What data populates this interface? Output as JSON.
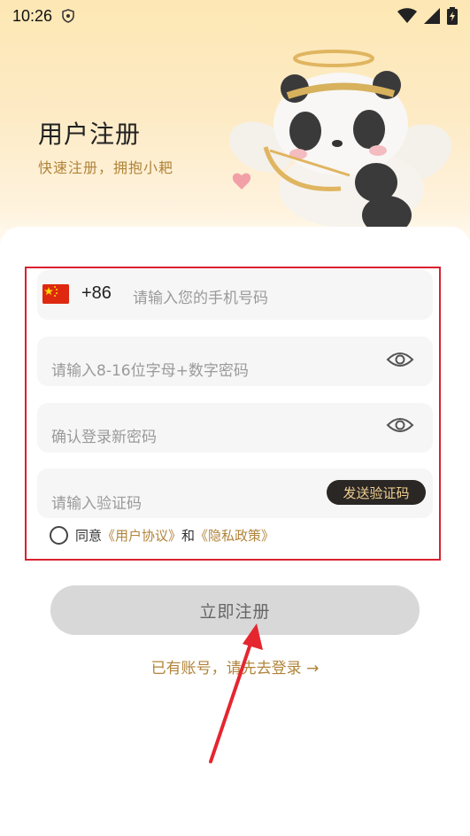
{
  "status_bar": {
    "time": "10:26",
    "icons": [
      "shield-icon",
      "wifi-icon",
      "signal-icon",
      "battery-charging-icon"
    ]
  },
  "header": {
    "title": "用户注册",
    "subtitle": "快速注册，拥抱小耙"
  },
  "form": {
    "phone": {
      "country_flag": "china-flag-icon",
      "country_code": "+86",
      "placeholder": "请输入您的手机号码"
    },
    "password": {
      "placeholder": "请输入8-16位字母+数字密码",
      "toggle_icon": "eye-icon"
    },
    "confirm_password": {
      "placeholder": "确认登录新密码",
      "toggle_icon": "eye-icon"
    },
    "verification": {
      "placeholder": "请输入验证码",
      "send_button": "发送验证码"
    },
    "agreement": {
      "prefix": "同意",
      "user_agreement": "《用户协议》",
      "conjunction": "和",
      "privacy_policy": "《隐私政策》",
      "checked": false
    }
  },
  "actions": {
    "register_button": "立即注册",
    "login_link": "已有账号，请先去登录 →"
  },
  "colors": {
    "accent": "#b0843a",
    "highlight_frame": "#d9212f",
    "send_button_bg": "#2a2725",
    "send_button_text": "#f2cf8f",
    "register_button_bg": "#d8d8d8"
  }
}
